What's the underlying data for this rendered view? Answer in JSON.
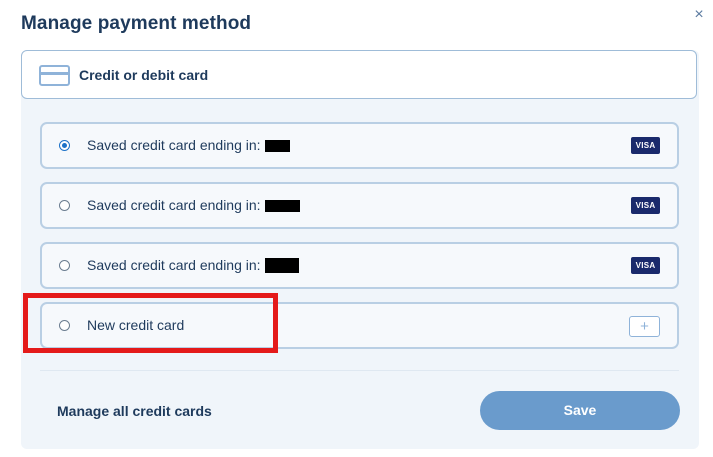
{
  "dialog": {
    "title": "Manage payment method",
    "close_symbol": "×"
  },
  "method": {
    "label": "Credit or debit card",
    "icon": "credit-card-icon"
  },
  "options": [
    {
      "label": "Saved credit card ending in:",
      "selected": true,
      "brand": "VISA",
      "redacted": true
    },
    {
      "label": "Saved credit card ending in:",
      "selected": false,
      "brand": "VISA",
      "redacted": true
    },
    {
      "label": "Saved credit card ending in:",
      "selected": false,
      "brand": "VISA",
      "redacted": true
    },
    {
      "label": "New credit card",
      "selected": false,
      "icon": "plus-icon",
      "plus_symbol": "+"
    }
  ],
  "footer": {
    "manage_label": "Manage all credit cards",
    "save_label": "Save"
  },
  "colors": {
    "accent": "#1d72c8",
    "save_button": "#6a9bcc",
    "visa_badge": "#1a2a6c",
    "highlight": "#e41a1a"
  }
}
